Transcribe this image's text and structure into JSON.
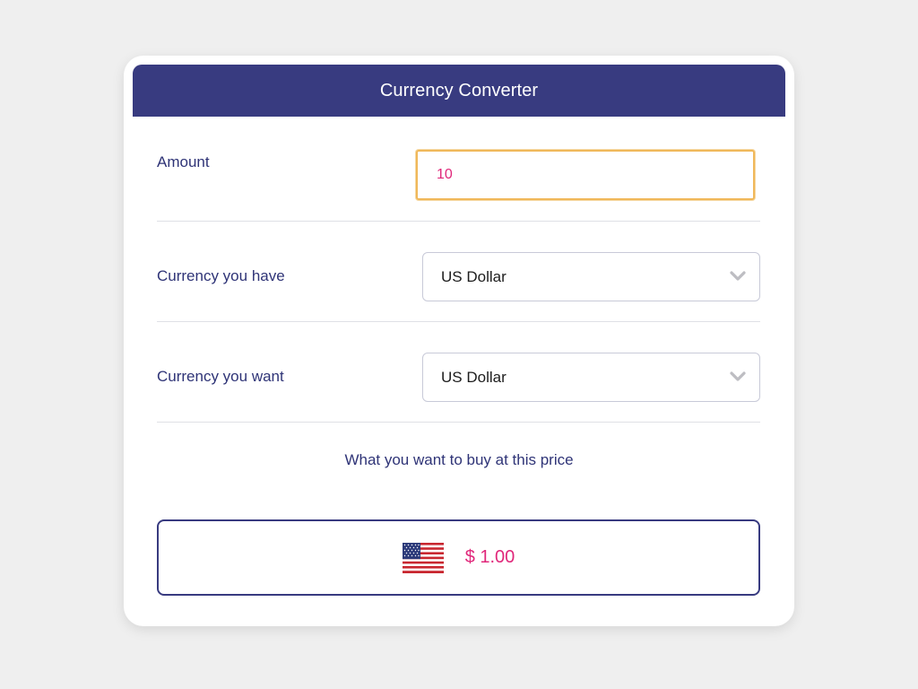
{
  "header": {
    "title": "Currency Converter"
  },
  "amount": {
    "label": "Amount",
    "value": "10"
  },
  "currency_have": {
    "label": "Currency you have",
    "selected": "US Dollar",
    "icon": "chevron-down-icon"
  },
  "currency_want": {
    "label": "Currency you want",
    "selected": "US Dollar",
    "icon": "chevron-down-icon"
  },
  "result": {
    "caption": "What you want to buy at this price",
    "flag_icon": "us-flag-icon",
    "value": "$ 1.00"
  },
  "colors": {
    "header_bg": "#383b80",
    "accent": "#e0277a",
    "focus_border": "#f0b85a",
    "label_text": "#2f3477"
  }
}
